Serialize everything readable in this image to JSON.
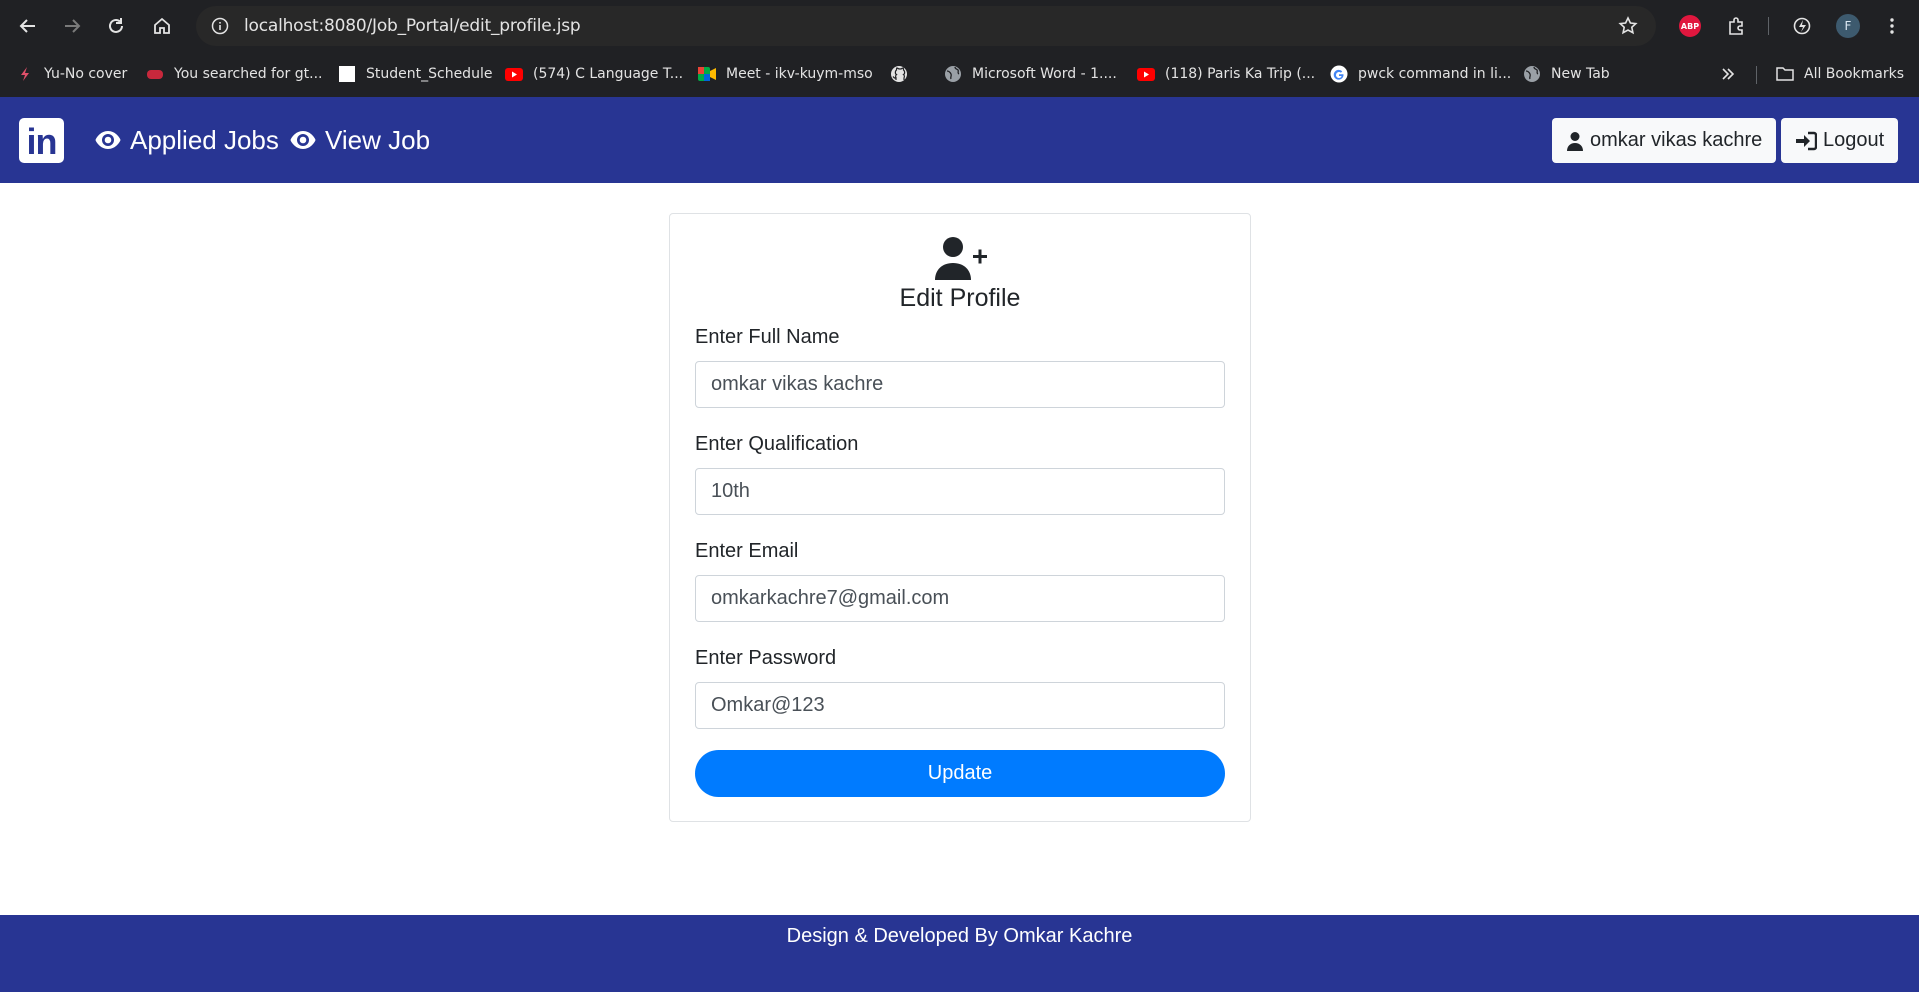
{
  "browser": {
    "url": "localhost:8080/Job_Portal/edit_profile.jsp",
    "profile_initial": "F",
    "abp_label": "ABP",
    "bookmarks": [
      {
        "label": "Yu-No cover",
        "icon": "bookmark-favicon"
      },
      {
        "label": "You searched for gt...",
        "icon": "game-favicon"
      },
      {
        "label": "Student_Schedule",
        "icon": "blank-page-favicon"
      },
      {
        "label": "(574) C Language T...",
        "icon": "youtube-icon"
      },
      {
        "label": "Meet - ikv-kuym-mso",
        "icon": "google-meet-icon"
      },
      {
        "label": "",
        "icon": "github-icon"
      },
      {
        "label": "Microsoft Word - 1....",
        "icon": "globe-icon"
      },
      {
        "label": "(118) Paris Ka Trip (...",
        "icon": "youtube-icon"
      },
      {
        "label": "pwck command in li...",
        "icon": "google-icon"
      },
      {
        "label": "New Tab",
        "icon": "globe-icon"
      }
    ],
    "all_bookmarks": "All Bookmarks"
  },
  "navbar": {
    "brand_text": "in",
    "links": [
      {
        "label": "Applied Jobs",
        "icon": "eye-icon"
      },
      {
        "label": "View Job",
        "icon": "eye-icon"
      }
    ],
    "user_button": "omkar vikas kachre",
    "logout_button": "Logout"
  },
  "form": {
    "title": "Edit Profile",
    "icon": "user-plus-icon",
    "fields": [
      {
        "label": "Enter Full Name",
        "value": "omkar vikas kachre"
      },
      {
        "label": "Enter Qualification",
        "value": "10th"
      },
      {
        "label": "Enter Email",
        "value": "omkarkachre7@gmail.com"
      },
      {
        "label": "Enter Password",
        "value": "Omkar@123"
      }
    ],
    "submit": "Update"
  },
  "footer": {
    "text": "Design & Developed By Omkar Kachre"
  },
  "colors": {
    "navbar_bg": "#283593",
    "button_primary": "#007bff",
    "chrome_bg": "#202124"
  }
}
